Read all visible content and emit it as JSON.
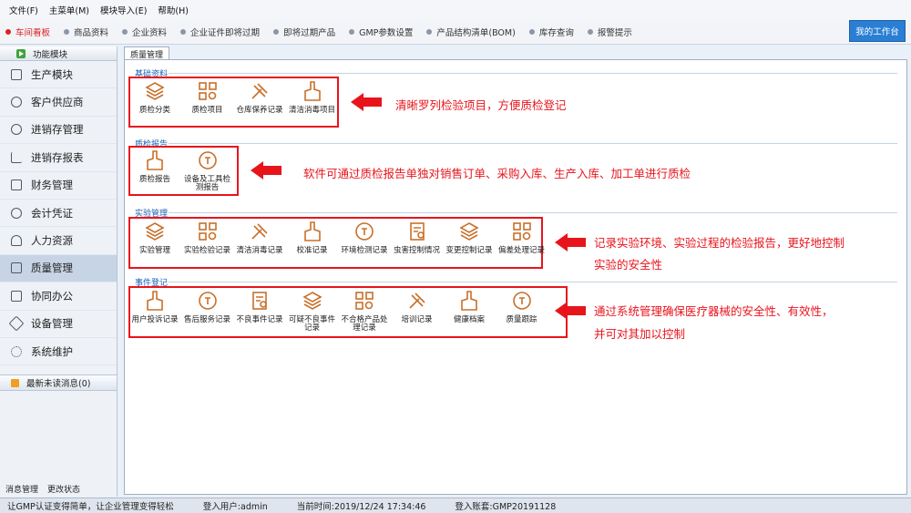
{
  "menu": [
    "文件(F)",
    "主菜单(M)",
    "模块导入(E)",
    "帮助(H)"
  ],
  "nav": [
    "车间看板",
    "商品资料",
    "企业资料",
    "企业证件即将过期",
    "即将过期产品",
    "GMP参数设置",
    "产品结构清单(BOM)",
    "库存查询",
    "报警提示"
  ],
  "workbench_btn": "我的工作台",
  "sidebar": {
    "header": "功能模块",
    "items": [
      "生产模块",
      "客户供应商",
      "进销存管理",
      "进销存报表",
      "财务管理",
      "会计凭证",
      "人力资源",
      "质量管理",
      "协同办公",
      "设备管理",
      "系统维护"
    ],
    "message_header": "最新未读消息(0)",
    "footer": [
      "消息管理",
      "更改状态"
    ]
  },
  "tab": "质量管理",
  "groups": [
    {
      "title": "基础资料",
      "items": [
        "质检分类",
        "质检项目",
        "仓库保养记录",
        "清洁消毒项目"
      ],
      "note": "清晰罗列检验项目，方便质检登记"
    },
    {
      "title": "质检报告",
      "items": [
        "质检报告",
        "设备及工具检测报告"
      ],
      "note": "软件可通过质检报告单独对销售订单、采购入库、生产入库、加工单进行质检"
    },
    {
      "title": "实验管理",
      "items": [
        "实验管理",
        "实验检验记录",
        "清洁消毒记录",
        "校准记录",
        "环境检测记录",
        "虫害控制情况",
        "变更控制记录",
        "偏差处理记录"
      ],
      "note": "记录实验环境、实验过程的检验报告，更好地控制",
      "note2": "实验的安全性"
    },
    {
      "title": "事件登记",
      "items": [
        "用户投诉记录",
        "售后服务记录",
        "不良事件记录",
        "可疑不良事件记录",
        "不合格产品处理记录",
        "培训记录",
        "健康档案",
        "质量跟踪"
      ],
      "note": "通过系统管理确保医疗器械的安全性、有效性，",
      "note2": "并可对其加以控制"
    }
  ],
  "status": {
    "slogan": "让GMP认证变得简单，让企业管理变得轻松",
    "user": "登入用户:admin",
    "time": "当前时间:2019/12/24 17:34:46",
    "account": "登入账套:GMP20191128"
  },
  "colors": {
    "accent": "#e8141c",
    "icon": "#c8702a",
    "active_nav": "#d22"
  }
}
